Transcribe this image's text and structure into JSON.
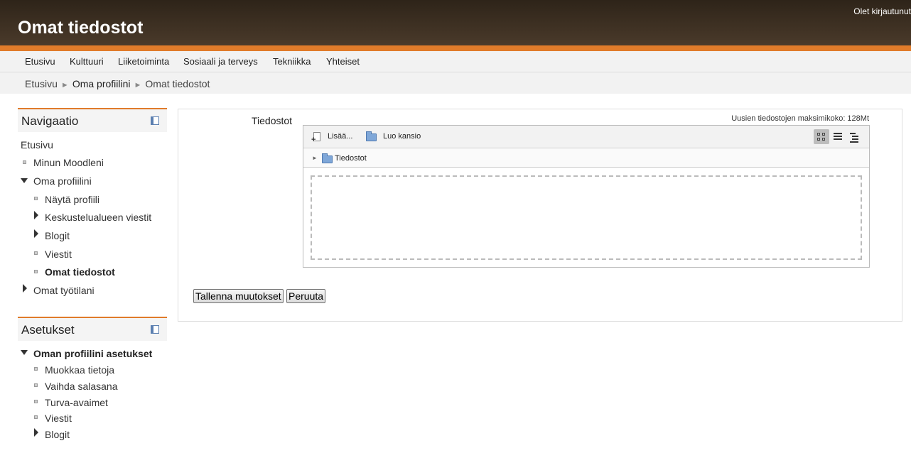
{
  "header": {
    "title": "Omat tiedostot",
    "login_info": "Olet kirjautunut"
  },
  "menu": [
    "Etusivu",
    "Kulttuuri",
    "Liiketoiminta",
    "Sosiaali ja terveys",
    "Tekniikka",
    "Yhteiset"
  ],
  "breadcrumb": [
    "Etusivu",
    "Oma profiilini",
    "Omat tiedostot"
  ],
  "navigation": {
    "title": "Navigaatio",
    "items": {
      "home": "Etusivu",
      "my_moodle": "Minun Moodleni",
      "my_profile": "Oma profiilini",
      "view_profile": "Näytä profiili",
      "forum_posts": "Keskustelualueen viestit",
      "blogs": "Blogit",
      "messages": "Viestit",
      "my_files": "Omat tiedostot",
      "my_courses": "Omat työtilani"
    }
  },
  "settings": {
    "title": "Asetukset",
    "items": {
      "profile_settings": "Oman profiilini asetukset",
      "edit_profile": "Muokkaa tietoja",
      "change_password": "Vaihda salasana",
      "security_keys": "Turva-avaimet",
      "messages": "Viestit",
      "blogs": "Blogit"
    }
  },
  "main": {
    "files_label": "Tiedostot",
    "max_size": "Uusien tiedostojen maksimikoko: 128Mt",
    "filemanager": {
      "add_label": "Lisää...",
      "create_folder_label": "Luo kansio",
      "path_label": "Tiedostot"
    },
    "save_label": "Tallenna muutokset",
    "cancel_label": "Peruuta"
  }
}
